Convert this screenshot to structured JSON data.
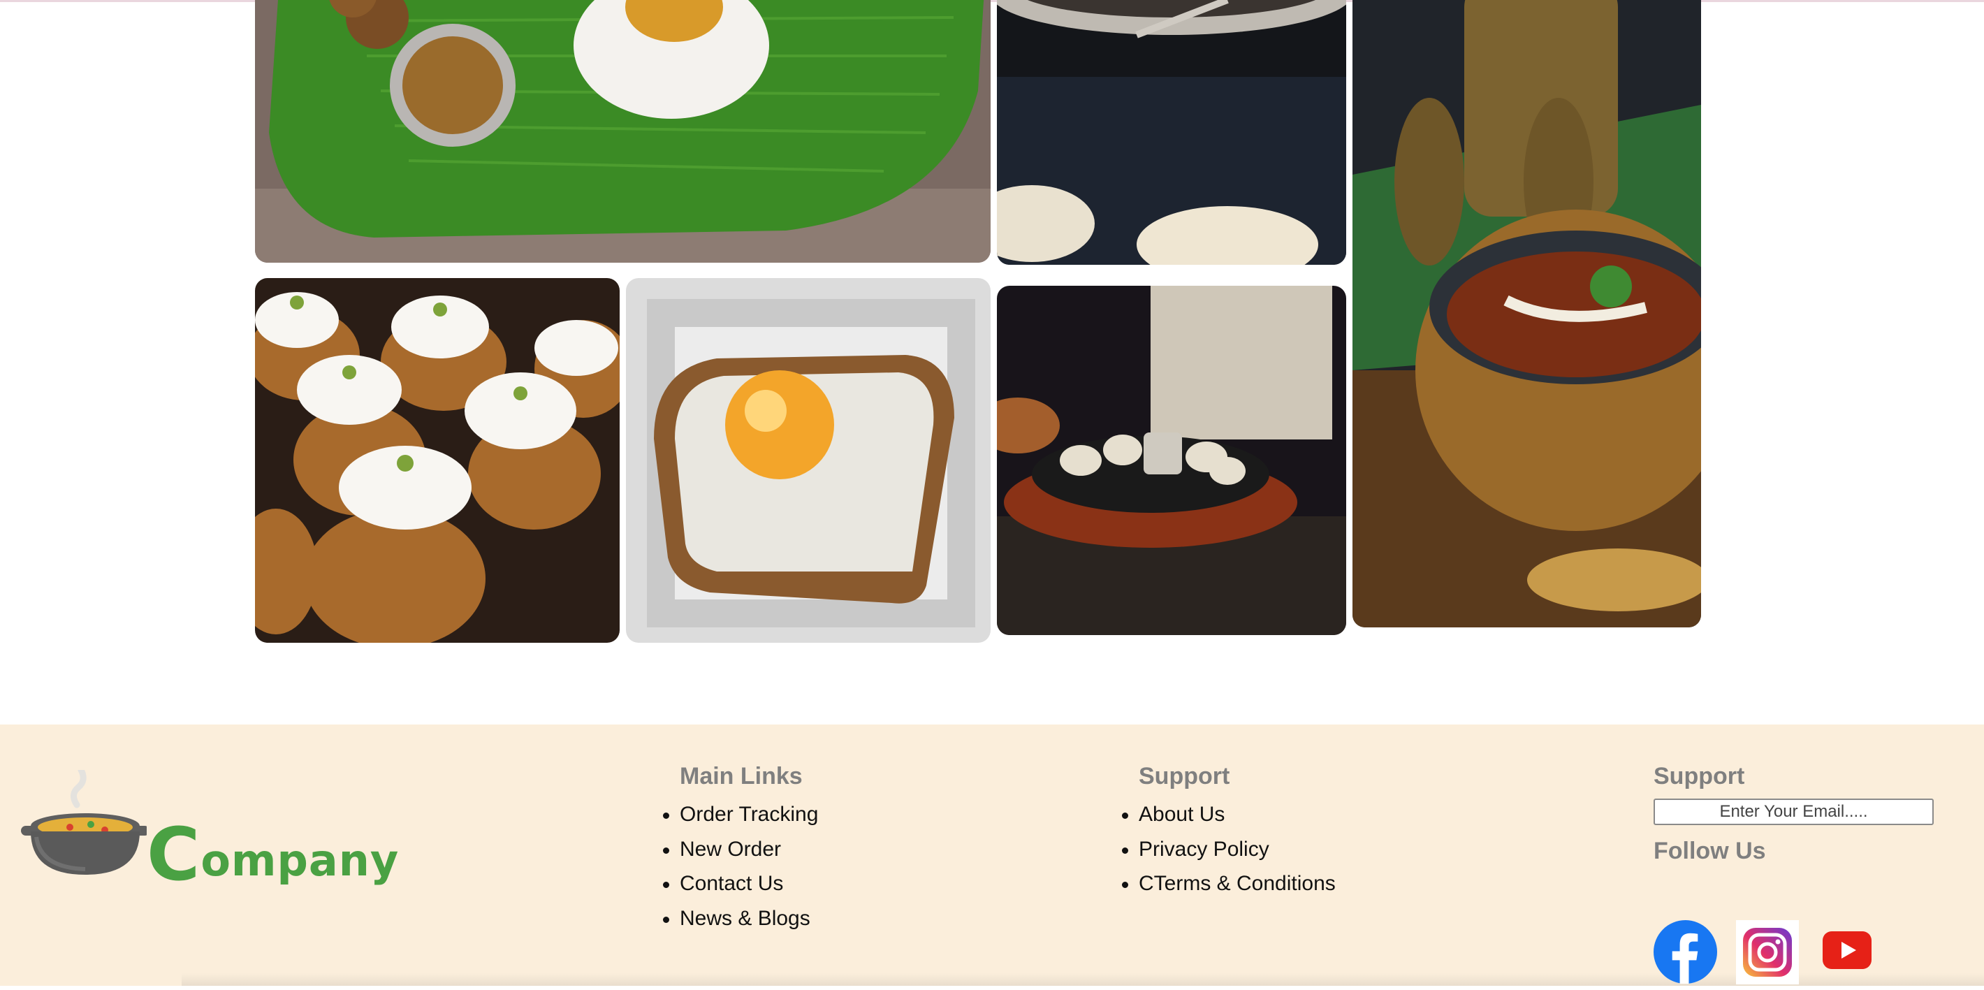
{
  "gallery": [
    {
      "name": "banana-leaf-rice-meal-image",
      "alt": "Rice and curry on a banana leaf"
    },
    {
      "name": "naan-on-dark-tray-image",
      "alt": "Flatbread on a dark tray"
    },
    {
      "name": "curry-in-brass-pot-image",
      "alt": "Curry served in a brass pot"
    },
    {
      "name": "cream-cupcakes-image",
      "alt": "Cupcakes topped with cream and pistachio"
    },
    {
      "name": "fried-egg-toast-image",
      "alt": "Fried egg on toast"
    },
    {
      "name": "momo-sizzler-plate-image",
      "alt": "Momos on a sizzler plate"
    }
  ],
  "footer": {
    "logo": {
      "letter": "C",
      "rest": "ompany"
    },
    "main_links": {
      "heading": "Main Links",
      "items": [
        "Order Tracking",
        "New Order",
        "Contact Us",
        "News & Blogs"
      ]
    },
    "support": {
      "heading": "Support",
      "items": [
        "About Us",
        "Privacy Policy",
        "CTerms & Conditions"
      ]
    },
    "subscribe": {
      "heading": "Support",
      "email_placeholder": "Enter Your Email.....",
      "follow_heading": "Follow Us"
    },
    "social_icons": [
      "facebook-icon",
      "instagram-icon",
      "youtube-icon"
    ]
  },
  "colors": {
    "footer_bg": "#fbeedb",
    "logo_green": "#4aa143",
    "heading_gray": "#7f7f7f",
    "facebook_blue": "#1877f2",
    "youtube_red": "#e62117"
  }
}
